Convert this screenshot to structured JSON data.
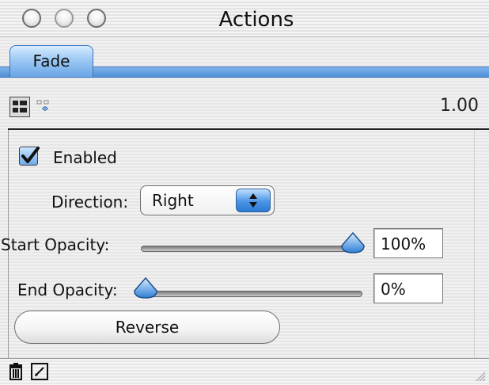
{
  "window": {
    "title": "Actions"
  },
  "tabs": [
    {
      "label": "Fade"
    }
  ],
  "toolbar": {
    "version": "1.00",
    "icons": [
      "list-view-icon",
      "tree-view-icon"
    ]
  },
  "panel": {
    "enabled": {
      "label": "Enabled",
      "checked": true
    },
    "direction": {
      "label": "Direction:",
      "value": "Right"
    },
    "start_opacity": {
      "label": "Start Opacity:",
      "value_text": "100%",
      "level": 1.0
    },
    "end_opacity": {
      "label": "End Opacity:",
      "value_text": "0%",
      "level": 0.0
    },
    "reverse": {
      "label": "Reverse"
    }
  },
  "bottombar": {
    "icons": [
      "trash-icon",
      "edit-icon"
    ]
  },
  "colors": {
    "accent": "#4f8fd6",
    "tab": "#9cc9f4"
  }
}
